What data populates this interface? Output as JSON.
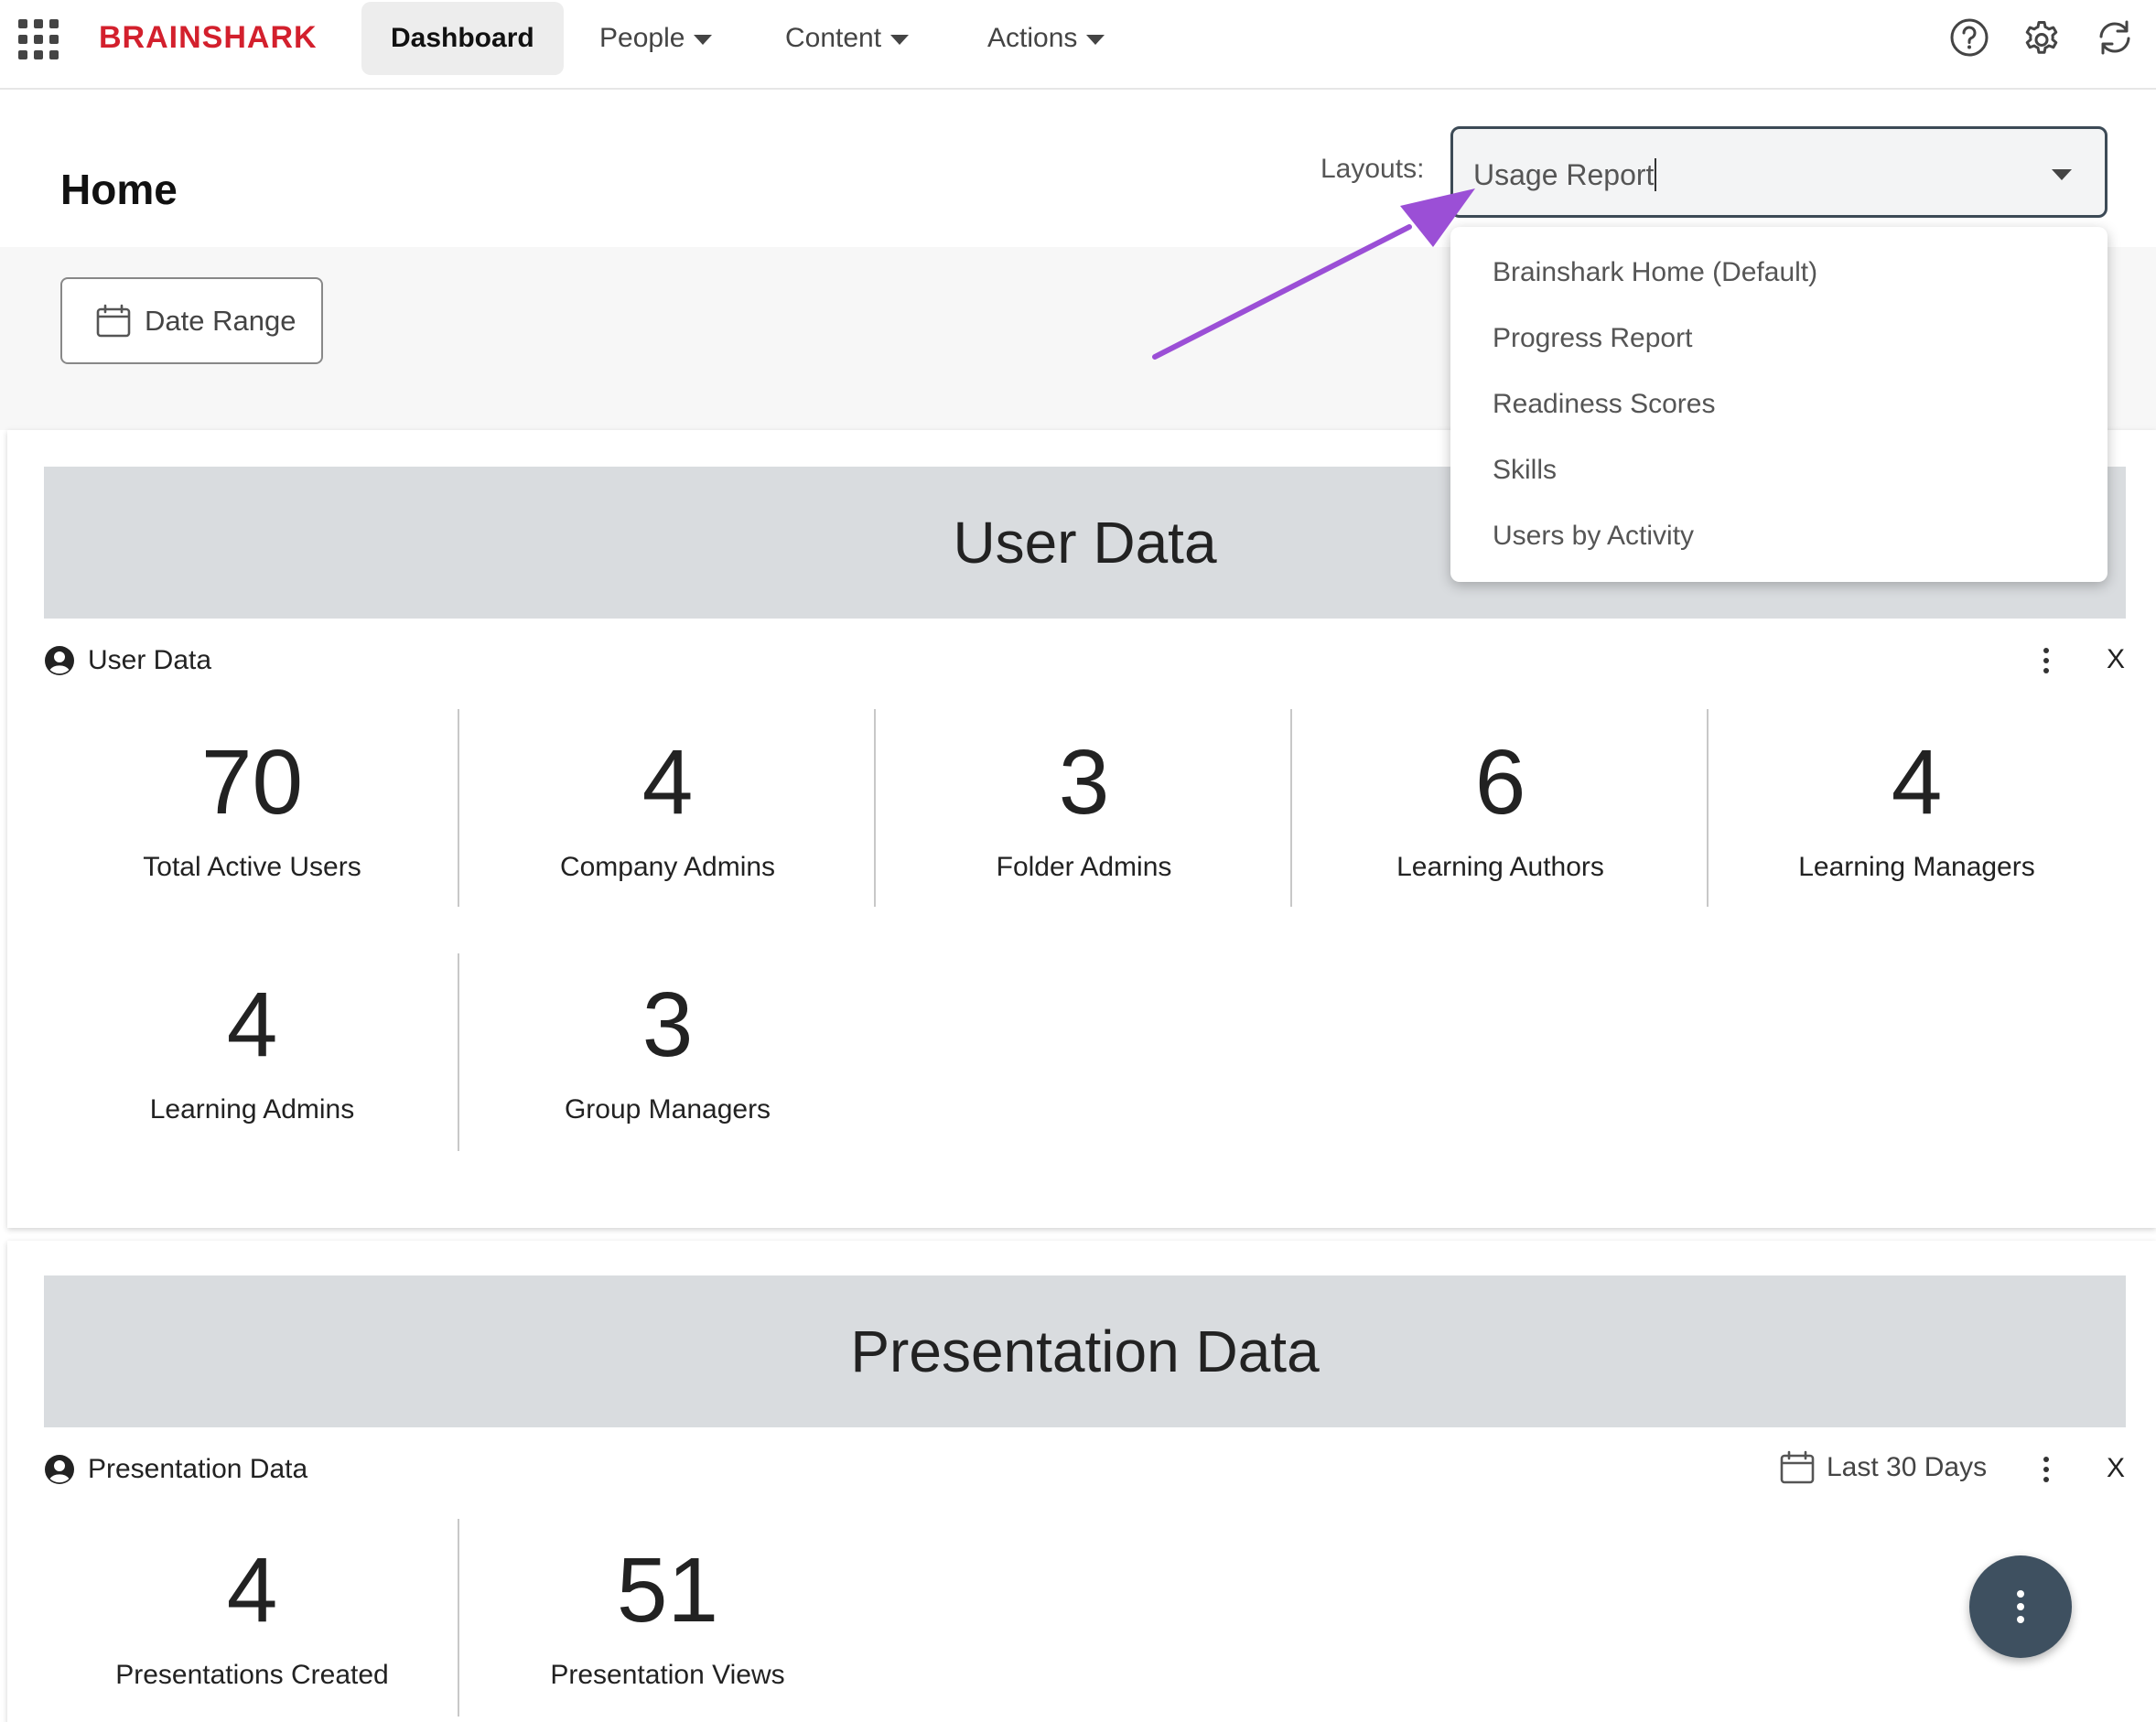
{
  "nav": {
    "logo": "BRAINSHARK",
    "items": [
      {
        "label": "Dashboard"
      },
      {
        "label": "People"
      },
      {
        "label": "Content"
      },
      {
        "label": "Actions"
      }
    ]
  },
  "header": {
    "title": "Home",
    "layouts_label": "Layouts:",
    "layout_value": "Usage Report"
  },
  "filters": {
    "date_range_label": "Date Range"
  },
  "layout_options": [
    {
      "label": "Brainshark Home (Default)"
    },
    {
      "label": "Progress Report"
    },
    {
      "label": "Readiness Scores"
    },
    {
      "label": "Skills"
    },
    {
      "label": "Users by Activity"
    }
  ],
  "user_data": {
    "banner": "User Data",
    "widget_title": "User Data",
    "close": "X",
    "stats": [
      {
        "value": "70",
        "label": "Total Active Users"
      },
      {
        "value": "4",
        "label": "Company Admins"
      },
      {
        "value": "3",
        "label": "Folder Admins"
      },
      {
        "value": "6",
        "label": "Learning Authors"
      },
      {
        "value": "4",
        "label": "Learning Managers"
      },
      {
        "value": "4",
        "label": "Learning Admins"
      },
      {
        "value": "3",
        "label": "Group Managers"
      }
    ]
  },
  "presentation_data": {
    "banner": "Presentation Data",
    "widget_title": "Presentation Data",
    "period": "Last 30 Days",
    "close": "X",
    "stats": [
      {
        "value": "4",
        "label": "Presentations Created"
      },
      {
        "value": "51",
        "label": "Presentation Views"
      }
    ]
  },
  "colors": {
    "brand": "#d3202d",
    "annotation_arrow": "#9b4fd6",
    "banner_bg": "#d9dcdf",
    "fab_bg": "#3e5060"
  },
  "icons": [
    "apps-grid-icon",
    "help-icon",
    "gear-icon",
    "sync-icon",
    "calendar-icon",
    "person-circle-icon",
    "kebab-icon",
    "chevron-down-icon"
  ]
}
